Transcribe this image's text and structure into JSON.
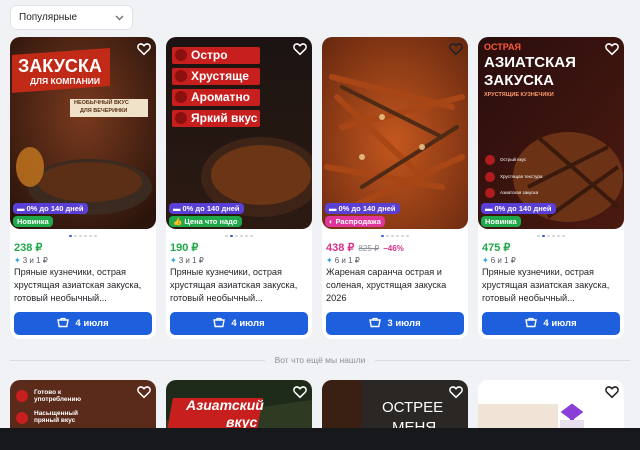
{
  "sort": {
    "label": "Популярные"
  },
  "products": [
    {
      "overlay": [
        "ЗАКУСКА",
        "ДЛЯ КОМПАНИИ",
        "НЕОБЫЧНЫЙ ВКУС",
        "ДЛЯ ВЕЧЕРИНКИ"
      ],
      "installment_badge": "0% до 140 дней",
      "second_badge": "Новинка",
      "price": "238 ₽",
      "installment": "3 и 1 ₽",
      "title": "Пряные кузнечики, острая хрустящая азиатская закуска, готовый необычный...",
      "delivery": "4 июля"
    },
    {
      "overlay": [
        "Остро",
        "Хрустяще",
        "Ароматно",
        "Яркий вкус"
      ],
      "installment_badge": "0% до 140 дней",
      "second_badge": "Цена что надо",
      "price": "190 ₽",
      "installment": "3 и 1 ₽",
      "title": "Пряные кузнечики, острая хрустящая азиатская закуска, готовый необычный...",
      "delivery": "4 июля"
    },
    {
      "installment_badge": "0% до 140 дней",
      "second_badge": "Распродажа",
      "price": "438 ₽",
      "old_price": "825 ₽",
      "discount": "−46%",
      "installment": "6 и 1 ₽",
      "title": "Жареная саранча острая и соленая, хрустящая закуска 2026",
      "delivery": "3 июля"
    },
    {
      "overlay": [
        "ОСТРАЯ",
        "АЗИАТСКАЯ",
        "ЗАКУСКА",
        "ХРУСТЯЩИЕ КУЗНЕЧИКИ",
        "Острый вкус",
        "Хрустящая текстура",
        "Азиатская закуска",
        "Готово к употреблению"
      ],
      "installment_badge": "0% до 140 дней",
      "second_badge": "Новинка",
      "price": "475 ₽",
      "installment": "6 и 1 ₽",
      "title": "Пряные кузнечики, острая хрустящая азиатская закуска, готовый необычный...",
      "delivery": "4 июля"
    }
  ],
  "divider_text": "Вот что ещё мы нашли",
  "more": [
    {
      "overlay": [
        "Готово к употреблению",
        "Насыщенный пряный вкус"
      ]
    },
    {
      "overlay": [
        "Азиатский",
        "вкус"
      ]
    },
    {
      "overlay": [
        "ОСТРЕЕ",
        "МЕНЯ"
      ]
    },
    {
      "overlay": []
    }
  ],
  "colors": {
    "accent": "#1d5fdc",
    "price_green": "#1fa84a",
    "price_sale": "#d6338a",
    "installment": "#5a3fd6"
  }
}
